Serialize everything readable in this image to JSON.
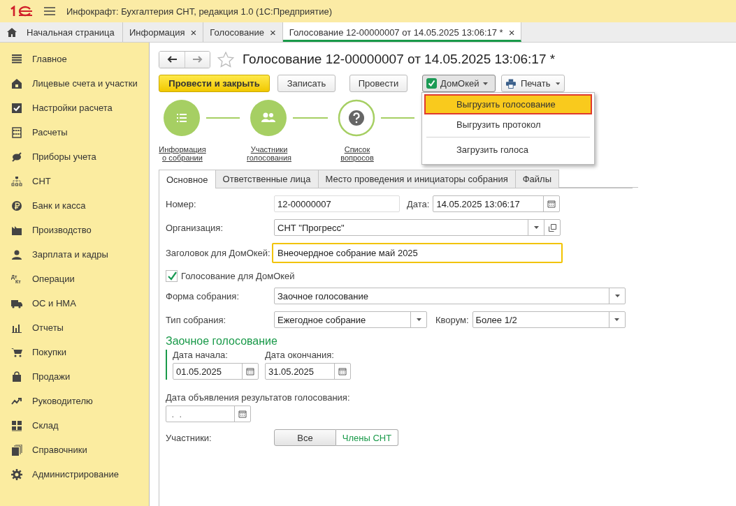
{
  "window": {
    "title": "Инфокрафт: Бухгалтерия СНТ, редакция 1.0  (1С:Предприятие)"
  },
  "open_tabs": [
    {
      "label": "Начальная страница",
      "selected": false,
      "closable": false
    },
    {
      "label": "Информация",
      "selected": false,
      "closable": true
    },
    {
      "label": "Голосование",
      "selected": false,
      "closable": true
    },
    {
      "label": "Голосование 12-00000007 от 14.05.2025 13:06:17 *",
      "selected": true,
      "closable": true
    }
  ],
  "close_glyph": "×",
  "sidebar": {
    "items": [
      {
        "label": "Главное"
      },
      {
        "label": "Лицевые счета и участки"
      },
      {
        "label": "Настройки расчета"
      },
      {
        "label": "Расчеты"
      },
      {
        "label": "Приборы учета"
      },
      {
        "label": "СНТ"
      },
      {
        "label": "Банк и касса"
      },
      {
        "label": "Производство"
      },
      {
        "label": "Зарплата и кадры"
      },
      {
        "label": "Операции",
        "icon_text": [
          "Дт",
          "Кт"
        ]
      },
      {
        "label": "ОС и НМА"
      },
      {
        "label": "Отчеты"
      },
      {
        "label": "Покупки"
      },
      {
        "label": "Продажи"
      },
      {
        "label": "Руководителю"
      },
      {
        "label": "Склад"
      },
      {
        "label": "Справочники"
      },
      {
        "label": "Администрирование"
      }
    ]
  },
  "document": {
    "title": "Голосование 12-00000007 от 14.05.2025 13:06:17 *",
    "favorite": false,
    "toolbar": [
      {
        "label": "Провести и закрыть",
        "kind": "primary"
      },
      {
        "label": "Записать",
        "kind": "plain"
      },
      {
        "label": "Провести",
        "kind": "plain"
      },
      {
        "label": "ДомОкей",
        "kind": "menu",
        "pressed": true
      },
      {
        "label": "Печать",
        "kind": "print",
        "pressed": false
      }
    ],
    "menu": [
      {
        "label": "Выгрузить голосование",
        "selected": true,
        "separator_before": false
      },
      {
        "label": "Выгрузить протокол",
        "selected": false,
        "separator_before": false
      },
      {
        "label": "Загрузить голоса",
        "selected": false,
        "separator_before": true
      }
    ],
    "steps": [
      {
        "label": "Информация о собрании",
        "done": true
      },
      {
        "label": "Участники голосования",
        "done": true
      },
      {
        "label": "Список вопросов",
        "done": false
      }
    ],
    "form_tabs": [
      {
        "label": "Основное",
        "selected": true
      },
      {
        "label": "Ответственные лица",
        "selected": false
      },
      {
        "label": "Место проведения и инициаторы собрания",
        "selected": false
      },
      {
        "label": "Файлы",
        "selected": false
      }
    ],
    "number": {
      "label": "Номер:",
      "value": "12-00000007"
    },
    "date": {
      "label": "Дата:",
      "value": "14.05.2025 13:06:17"
    },
    "organization": {
      "label": "Организация:",
      "value": "СНТ \"Прогресс\""
    },
    "heading": {
      "label": "Заголовок для ДомОкей:",
      "value": "Внеочердное собрание май 2025"
    },
    "domokey_voting": {
      "label": "Голосование для ДомОкей",
      "checked": true
    },
    "meeting_form": {
      "label": "Форма собрания:",
      "value": "Заочное голосование"
    },
    "meeting_type": {
      "label": "Тип собрания:",
      "value": "Ежегодное собрание"
    },
    "quorum": {
      "label": "Кворум:",
      "value": "Более 1/2"
    },
    "section": {
      "title": "Заочное голосование",
      "start": {
        "label": "Дата начала:",
        "value": "01.05.2025"
      },
      "end": {
        "label": "Дата окончания:",
        "value": "31.05.2025"
      }
    },
    "results_date": {
      "label": "Дата объявления результатов голосования:",
      "placeholder": " .  ."
    },
    "participants": {
      "label": "Участники:",
      "options": [
        {
          "label": "Все",
          "selected": false
        },
        {
          "label": "Члены СНТ",
          "selected": true
        }
      ]
    }
  }
}
